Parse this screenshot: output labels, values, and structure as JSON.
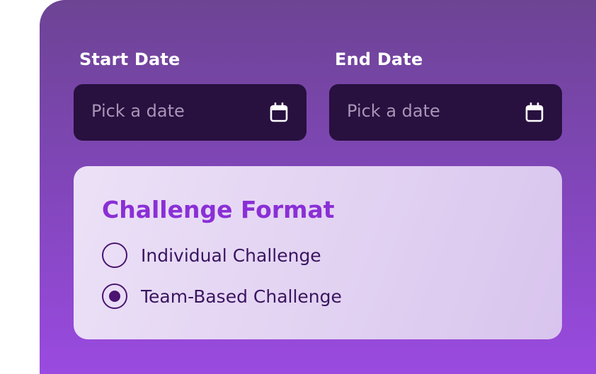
{
  "form": {
    "start_date": {
      "label": "Start Date",
      "placeholder": "Pick a date",
      "icon": "calendar-icon"
    },
    "end_date": {
      "label": "End Date",
      "placeholder": "Pick a date",
      "icon": "calendar-icon"
    },
    "challenge_format": {
      "title": "Challenge Format",
      "options": [
        {
          "label": "Individual Challenge",
          "selected": false
        },
        {
          "label": "Team-Based Challenge",
          "selected": true
        }
      ]
    }
  },
  "colors": {
    "accent": "#8a2fd6",
    "input_bg": "#28103f",
    "radio": "#4a1470"
  }
}
